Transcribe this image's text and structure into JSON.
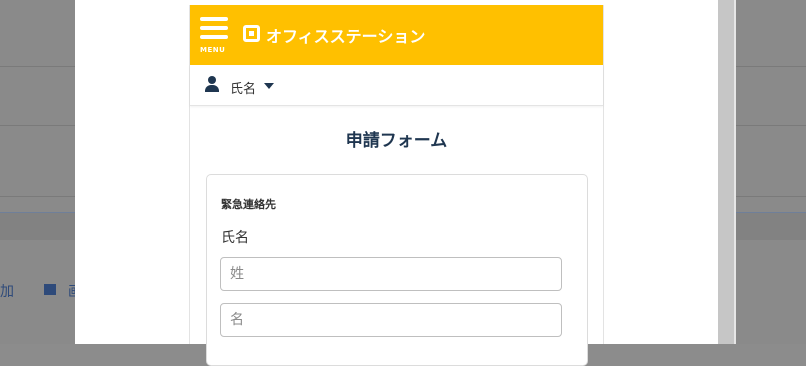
{
  "background": {
    "left_text_1": "加",
    "left_text_2": "画"
  },
  "header": {
    "menu_label": "MENU",
    "logo_text": "オフィスステーション",
    "brand_color": "#ffc000"
  },
  "user": {
    "name": "氏名"
  },
  "form": {
    "title": "申請フォーム",
    "section_label": "緊急連絡先",
    "field_label": "氏名",
    "last_name": {
      "value": "",
      "placeholder": "姓"
    },
    "first_name": {
      "value": "",
      "placeholder": "名"
    }
  },
  "icons": {
    "menu": "hamburger-icon",
    "logo": "logo-icon",
    "user": "user-icon",
    "dropdown": "caret-down-icon",
    "background_image": "image-icon"
  }
}
